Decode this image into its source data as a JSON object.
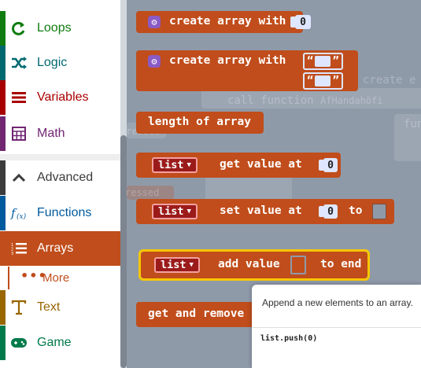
{
  "sidebar": {
    "items": [
      {
        "label": "Loops",
        "icon": "loop-icon",
        "color": "#107c10"
      },
      {
        "label": "Logic",
        "icon": "shuffle-icon",
        "color": "#006970"
      },
      {
        "label": "Variables",
        "icon": "list-icon",
        "color": "#a80000"
      },
      {
        "label": "Math",
        "icon": "calculator-icon",
        "color": "#712672"
      },
      {
        "label": "Advanced",
        "icon": "chevron-up-icon",
        "color": "#3c3c3c"
      },
      {
        "label": "Functions",
        "icon": "function-icon",
        "color": "#005a9e"
      },
      {
        "label": "Arrays",
        "icon": "numbered-list-icon",
        "color": "#c04d1b"
      },
      {
        "label": "More",
        "icon": "more-dots-icon",
        "color": "#c04d1b"
      },
      {
        "label": "Text",
        "icon": "text-icon",
        "color": "#996600"
      },
      {
        "label": "Game",
        "icon": "gamepad-icon",
        "color": "#007a4b"
      }
    ]
  },
  "blocks": {
    "create_array_label": "create array with",
    "create_array_num": "0",
    "create_array2_label": "create array with",
    "quote_open": "“",
    "quote_close": "”",
    "length_label": "length of array",
    "get_var": "list",
    "get_label": "get value at",
    "get_num": "0",
    "set_var": "list",
    "set_label": "set value at",
    "set_num": "0",
    "set_to": "to",
    "add_var": "list",
    "add_label": "add value",
    "add_end": "to end",
    "remove_label": "get and remove"
  },
  "background": {
    "create_e": "create e",
    "call_function": "call function",
    "call_name": "AfHandahöfi",
    "pressed1": "pressed",
    "pressed2": "ressed",
    "fun": "fun"
  },
  "tooltip": {
    "description": "Append a new elements to an array.",
    "code": "list.push(0)"
  },
  "colors": {
    "accent": "#c04d1b",
    "gear": "#8a5bc6",
    "highlight": "#f7c600"
  }
}
